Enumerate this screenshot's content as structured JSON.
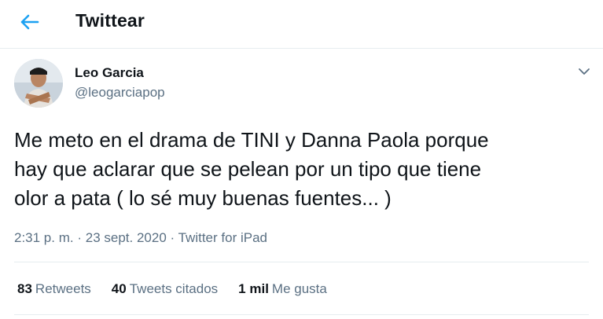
{
  "header": {
    "title": "Twittear",
    "back_icon": "arrow-left-icon",
    "accent_color": "#1da1f2"
  },
  "tweet": {
    "author_name": "Leo Garcia",
    "author_handle": "@leogarciapop",
    "caret_icon": "chevron-down-icon",
    "text": "Me meto en el drama de TINI y Danna Paola porque\nhay que aclarar que se pelean por un tipo que tiene\nolor a pata ( lo sé muy buenas fuentes... )",
    "time": "2:31 p. m.",
    "date": "23 sept. 2020",
    "separator": "·",
    "source": "Twitter for iPad"
  },
  "stats": {
    "retweets_count": "83",
    "retweets_label": "Retweets",
    "quotes_count": "40",
    "quotes_label": "Tweets citados",
    "likes_count": "1 mil",
    "likes_label": "Me gusta"
  }
}
